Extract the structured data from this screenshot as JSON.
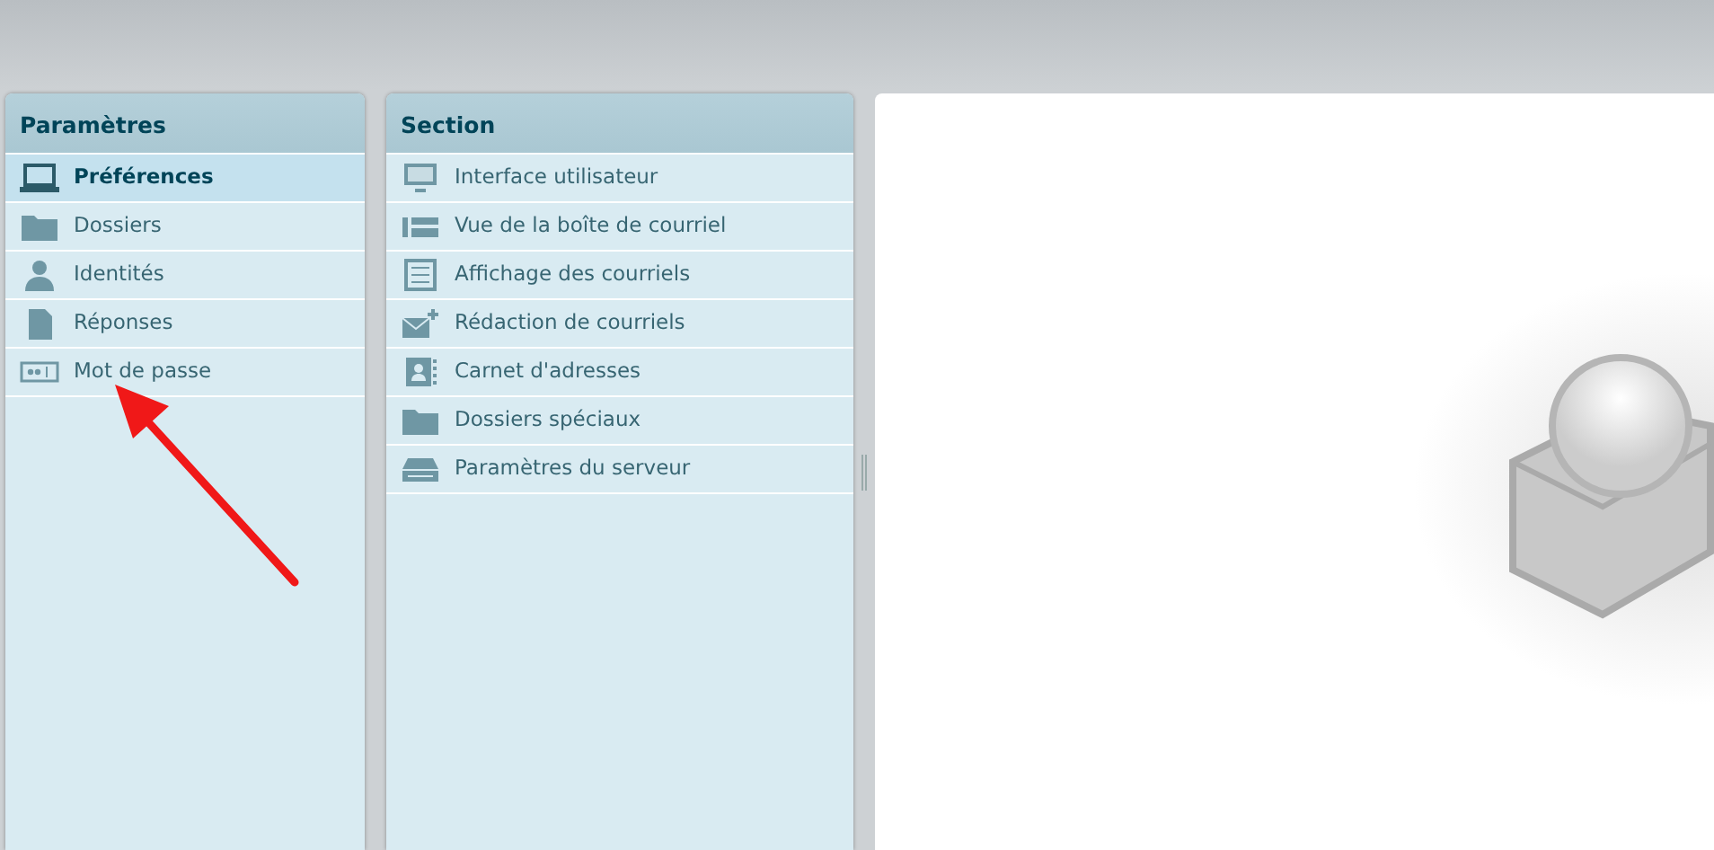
{
  "settings_panel": {
    "title": "Paramètres",
    "items": [
      {
        "label": "Préférences",
        "selected": true
      },
      {
        "label": "Dossiers",
        "selected": false
      },
      {
        "label": "Identités",
        "selected": false
      },
      {
        "label": "Réponses",
        "selected": false
      },
      {
        "label": "Mot de passe",
        "selected": false
      }
    ]
  },
  "section_panel": {
    "title": "Section",
    "items": [
      {
        "label": "Interface utilisateur",
        "selected": false
      },
      {
        "label": "Vue de la boîte de courriel",
        "selected": false
      },
      {
        "label": "Affichage des courriels",
        "selected": false
      },
      {
        "label": "Rédaction de courriels",
        "selected": false
      },
      {
        "label": "Carnet d'adresses",
        "selected": false
      },
      {
        "label": "Dossiers spéciaux",
        "selected": false
      },
      {
        "label": "Paramètres du serveur",
        "selected": false
      }
    ]
  }
}
